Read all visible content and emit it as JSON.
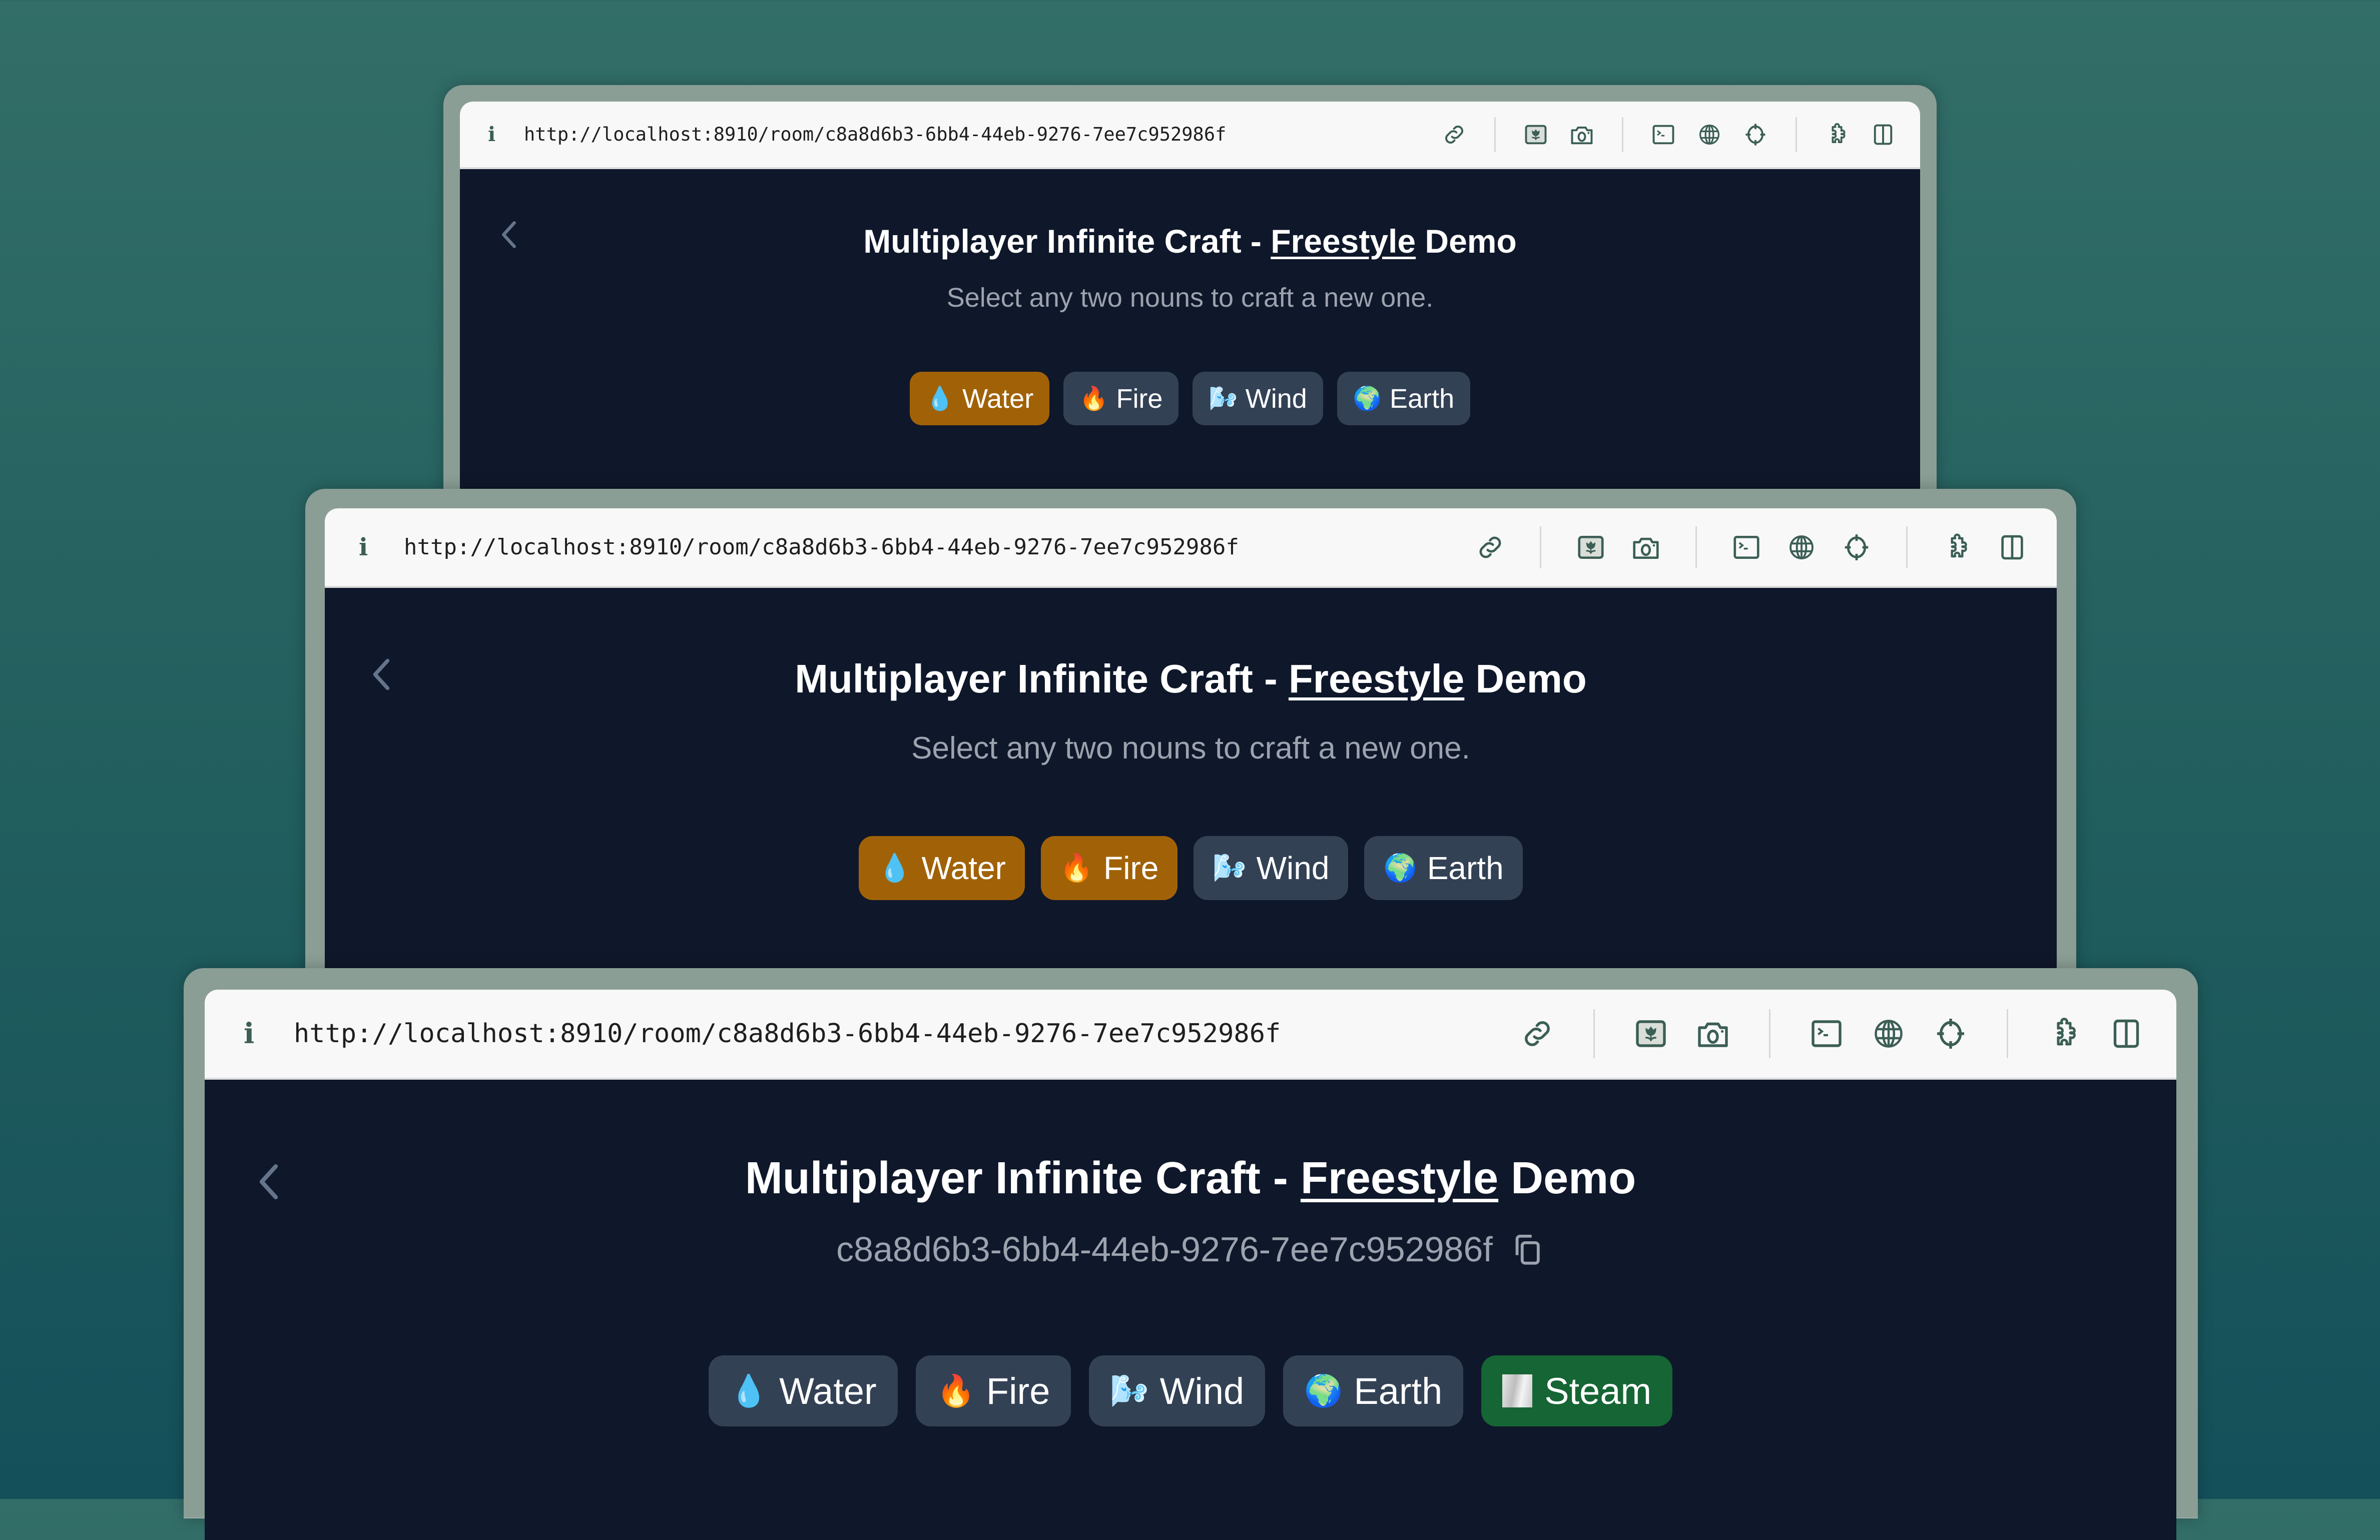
{
  "background": {
    "gradient_top": "#336e68",
    "gradient_bottom": "#14505a"
  },
  "colors": {
    "frame": "#8a9e95",
    "toolbar_bg": "#f8f8f8",
    "toolbar_icon": "#3b5e55",
    "page_bg": "#0f172a",
    "chip_default": "#334155",
    "chip_selected": "#a16207",
    "chip_new": "#166534",
    "subtitle": "#9ca3af",
    "back_chevron": "#64748b"
  },
  "toolbar": {
    "info_icon": "info-icon",
    "url": "http://localhost:8910/room/c8a8d6b3-6bb4-44eb-9276-7ee7c952986f",
    "icons": [
      "link-icon",
      "image-icon",
      "camera-icon",
      "terminal-icon",
      "globe-icon",
      "crosshair-icon",
      "puzzle-icon",
      "split-view-icon"
    ]
  },
  "page": {
    "title_prefix": "Multiplayer Infinite Craft - ",
    "title_link": "Freestyle",
    "title_suffix": " Demo",
    "subtitle": "Select any two nouns to craft a new one.",
    "room_id": "c8a8d6b3-6bb4-44eb-9276-7ee7c952986f"
  },
  "windows": [
    {
      "label": "before selection",
      "elements": [
        {
          "emoji": "💧",
          "label": "Water",
          "state": "selected"
        },
        {
          "emoji": "🔥",
          "label": "Fire",
          "state": "default"
        },
        {
          "emoji": "🌬️",
          "label": "Wind",
          "state": "default"
        },
        {
          "emoji": "🌍",
          "label": "Earth",
          "state": "default"
        }
      ]
    },
    {
      "label": "two selected",
      "elements": [
        {
          "emoji": "💧",
          "label": "Water",
          "state": "selected"
        },
        {
          "emoji": "🔥",
          "label": "Fire",
          "state": "selected"
        },
        {
          "emoji": "🌬️",
          "label": "Wind",
          "state": "default"
        },
        {
          "emoji": "🌍",
          "label": "Earth",
          "state": "default"
        }
      ]
    },
    {
      "label": "crafted result",
      "elements": [
        {
          "emoji": "💧",
          "label": "Water",
          "state": "default"
        },
        {
          "emoji": "🔥",
          "label": "Fire",
          "state": "default"
        },
        {
          "emoji": "🌬️",
          "label": "Wind",
          "state": "default"
        },
        {
          "emoji": "🌍",
          "label": "Earth",
          "state": "default"
        },
        {
          "emoji": "steam-image",
          "label": "Steam",
          "state": "new"
        }
      ]
    }
  ]
}
